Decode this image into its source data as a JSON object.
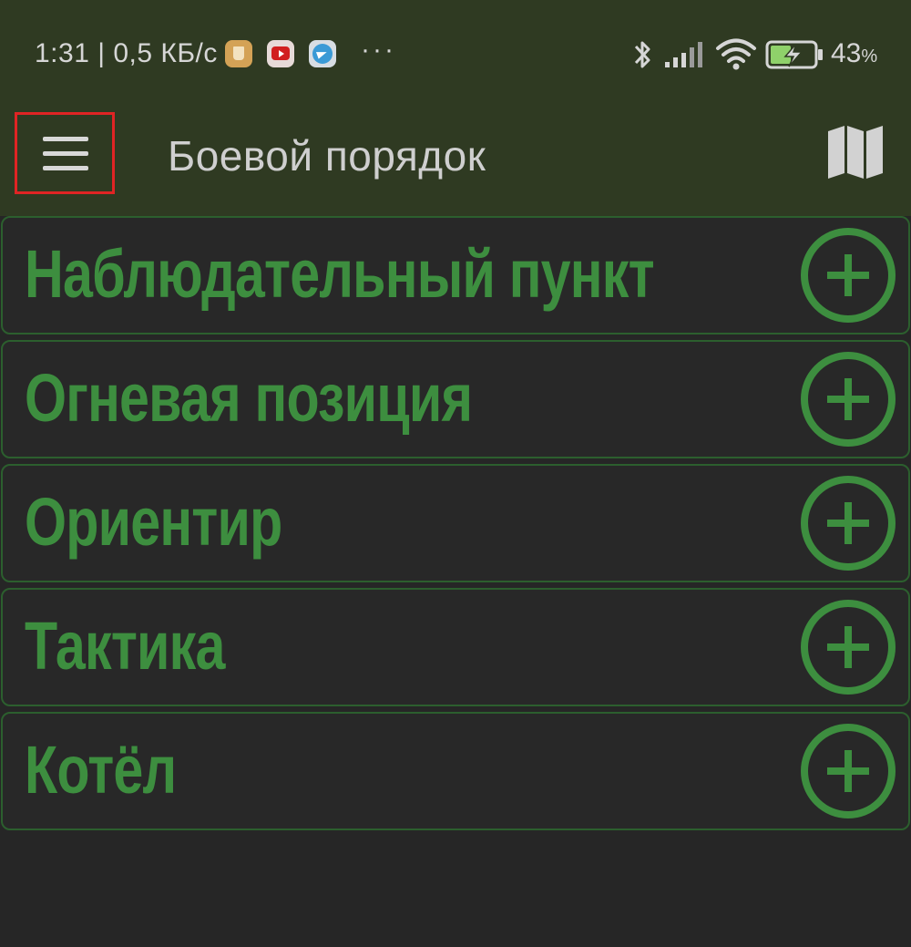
{
  "status_bar": {
    "time_speed": "1:31 | 0,5 КБ/с",
    "overflow": "···",
    "battery_percent": "43",
    "percent_symbol": "%",
    "icons": [
      "notification-app-icon",
      "youtube-icon",
      "telegram-icon",
      "bluetooth-icon",
      "signal-icon",
      "wifi-icon",
      "battery-charging-icon"
    ]
  },
  "app_bar": {
    "title": "Боевой порядок",
    "menu_icon": "hamburger-menu-icon",
    "map_icon": "map-icon"
  },
  "list": {
    "items": [
      {
        "label": "Наблюдательный пункт",
        "action_icon": "add-circle-icon"
      },
      {
        "label": "Огневая позиция",
        "action_icon": "add-circle-icon"
      },
      {
        "label": "Ориентир",
        "action_icon": "add-circle-icon"
      },
      {
        "label": "Тактика",
        "action_icon": "add-circle-icon"
      },
      {
        "label": "Котёл",
        "action_icon": "add-circle-icon"
      }
    ]
  },
  "colors": {
    "background": "#262626",
    "header": "#2f3a22",
    "accent_green": "#3d8e3f",
    "card_border": "#2c5f2e",
    "highlight_red": "#e02424"
  }
}
